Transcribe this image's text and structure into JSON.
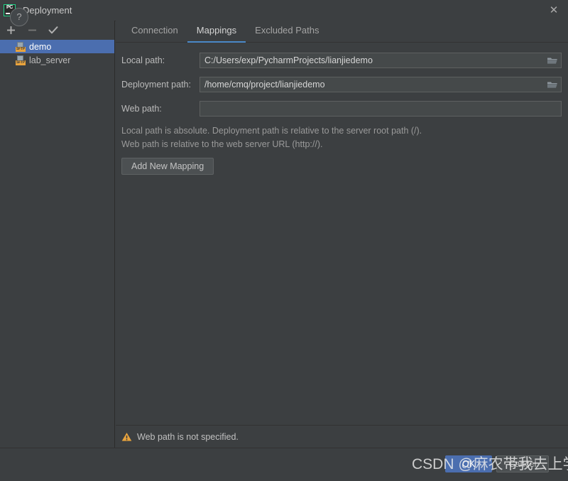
{
  "window": {
    "title": "Deployment",
    "app_icon": "pycharm-logo",
    "close_label": "✕"
  },
  "sidebar": {
    "toolbar": [
      {
        "name": "add",
        "glyph": "+",
        "enabled": true
      },
      {
        "name": "remove",
        "glyph": "−",
        "enabled": false
      },
      {
        "name": "set-default",
        "glyph": "✓",
        "enabled": true
      }
    ],
    "servers": [
      {
        "label": "demo",
        "badge": "SFTP",
        "selected": true
      },
      {
        "label": "lab_server",
        "badge": "SFTP",
        "selected": false
      }
    ]
  },
  "tabs": [
    {
      "label": "Connection",
      "active": false
    },
    {
      "label": "Mappings",
      "active": true
    },
    {
      "label": "Excluded Paths",
      "active": false
    }
  ],
  "form": {
    "rows": [
      {
        "label": "Local path:",
        "value": "C:/Users/exp/PycharmProjects/lianjiedemo",
        "placeholder": "",
        "has_browse": true
      },
      {
        "label": "Deployment path:",
        "value": "/home/cmq/project/lianjiedemo",
        "placeholder": "",
        "has_browse": true
      },
      {
        "label": "Web path:",
        "value": "",
        "placeholder": "",
        "has_browse": false
      }
    ],
    "hint_line1": "Local path is absolute. Deployment path is relative to the server root path (/).",
    "hint_line2": "Web path is relative to the web server URL (http://).",
    "add_mapping_label": "Add New Mapping"
  },
  "status": {
    "icon": "warning-icon",
    "text": "Web path is not specified.",
    "color": "#e8a33d"
  },
  "footer": {
    "help_label": "?",
    "ok_label": "OK",
    "cancel_label": "Cancel"
  },
  "watermark": {
    "text": "CSDN @麻农带我去上学"
  },
  "colors": {
    "background": "#3c3f41",
    "field": "#45494a",
    "selection": "#4b6eaf",
    "accent": "#4a88c7",
    "warning": "#e8a33d",
    "logo_green": "#21d789"
  }
}
